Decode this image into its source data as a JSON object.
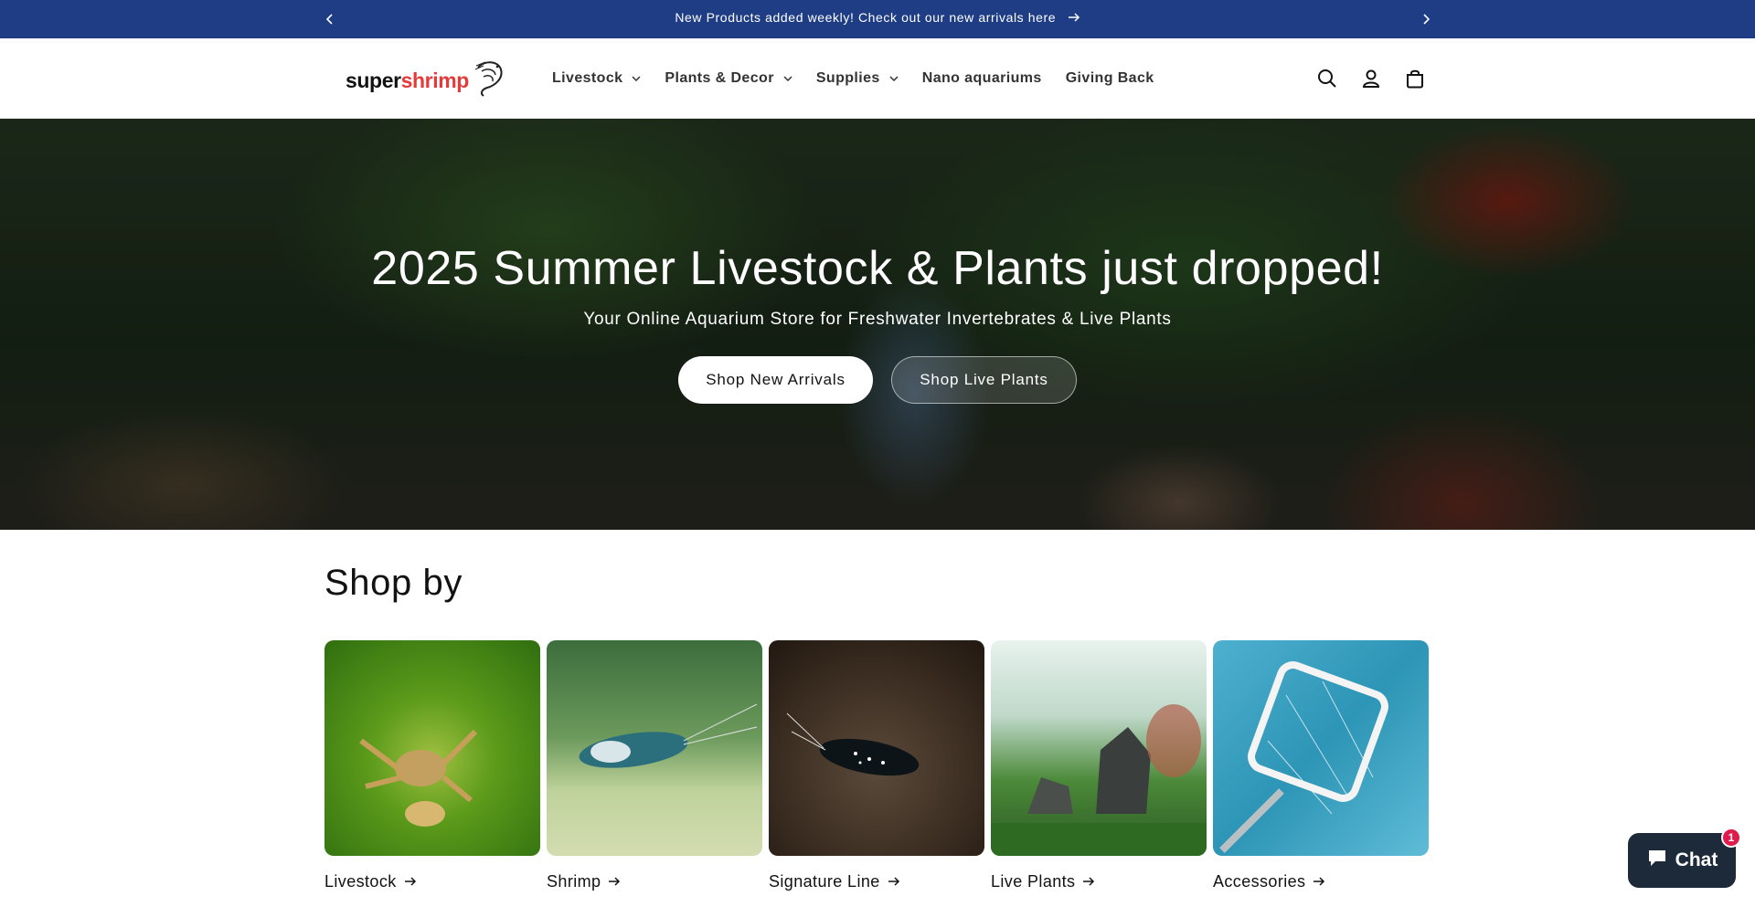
{
  "announcement": {
    "message": "New Products added weekly! Check out our new arrivals here",
    "bg_color": "#1e3d85"
  },
  "header": {
    "logo": {
      "part1": "super",
      "part2": "shrimp",
      "accent_color": "#e63a3a"
    },
    "nav": [
      {
        "label": "Livestock",
        "has_dropdown": true
      },
      {
        "label": "Plants & Decor",
        "has_dropdown": true
      },
      {
        "label": "Supplies",
        "has_dropdown": true
      },
      {
        "label": "Nano aquariums",
        "has_dropdown": false
      },
      {
        "label": "Giving Back",
        "has_dropdown": false
      }
    ],
    "icons": [
      "search-icon",
      "account-icon",
      "cart-icon"
    ]
  },
  "hero": {
    "title": "2025 Summer Livestock & Plants just dropped!",
    "subtitle": "Your Online Aquarium Store for Freshwater Invertebrates & Live Plants",
    "primary_button": "Shop New Arrivals",
    "secondary_button": "Shop Live Plants"
  },
  "shop_by": {
    "title": "Shop by",
    "categories": [
      {
        "label": "Livestock"
      },
      {
        "label": "Shrimp"
      },
      {
        "label": "Signature Line"
      },
      {
        "label": "Live Plants"
      },
      {
        "label": "Accessories"
      }
    ]
  },
  "chat": {
    "label": "Chat",
    "badge": "1"
  }
}
